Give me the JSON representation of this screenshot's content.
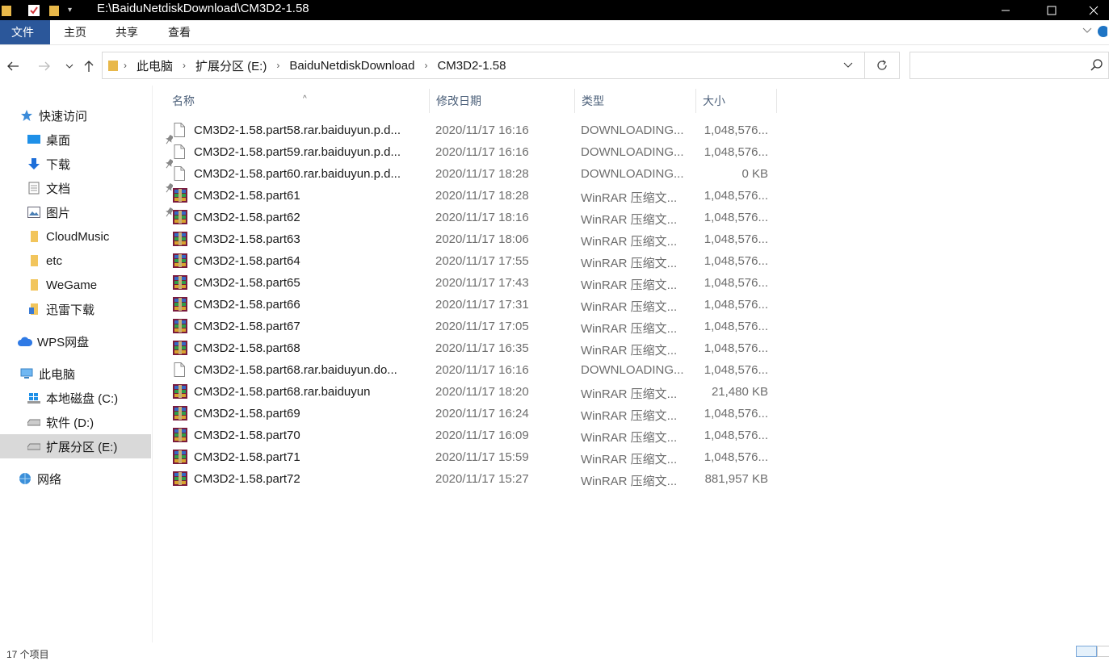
{
  "window": {
    "path": "E:\\BaiduNetdiskDownload\\CM3D2-1.58"
  },
  "ribbon": {
    "tabs": [
      "文件",
      "主页",
      "共享",
      "查看"
    ]
  },
  "breadcrumb": [
    "此电脑",
    "扩展分区 (E:)",
    "BaiduNetdiskDownload",
    "CM3D2-1.58"
  ],
  "search": {
    "placeholder": ""
  },
  "nav": {
    "quick_access": "快速访问",
    "pinned": [
      "桌面",
      "下载",
      "文档",
      "图片"
    ],
    "folders": [
      "CloudMusic",
      "etc",
      "WeGame",
      "迅雷下载"
    ],
    "wps": "WPS网盘",
    "this_pc": "此电脑",
    "drives": [
      "本地磁盘 (C:)",
      "软件 (D:)",
      "扩展分区 (E:)"
    ],
    "network": "网络"
  },
  "columns": {
    "name": "名称",
    "date": "修改日期",
    "type": "类型",
    "size": "大小"
  },
  "files": [
    {
      "name": "CM3D2-1.58.part58.rar.baiduyun.p.d...",
      "date": "2020/11/17 16:16",
      "type": "DOWNLOADING...",
      "size": "1,048,576...",
      "icon": "blank-file-icon"
    },
    {
      "name": "CM3D2-1.58.part59.rar.baiduyun.p.d...",
      "date": "2020/11/17 16:16",
      "type": "DOWNLOADING...",
      "size": "1,048,576...",
      "icon": "blank-file-icon"
    },
    {
      "name": "CM3D2-1.58.part60.rar.baiduyun.p.d...",
      "date": "2020/11/17 18:28",
      "type": "DOWNLOADING...",
      "size": "0 KB",
      "icon": "blank-file-icon"
    },
    {
      "name": "CM3D2-1.58.part61",
      "date": "2020/11/17 18:28",
      "type": "WinRAR 压缩文...",
      "size": "1,048,576...",
      "icon": "winrar-icon"
    },
    {
      "name": "CM3D2-1.58.part62",
      "date": "2020/11/17 18:16",
      "type": "WinRAR 压缩文...",
      "size": "1,048,576...",
      "icon": "winrar-icon"
    },
    {
      "name": "CM3D2-1.58.part63",
      "date": "2020/11/17 18:06",
      "type": "WinRAR 压缩文...",
      "size": "1,048,576...",
      "icon": "winrar-icon"
    },
    {
      "name": "CM3D2-1.58.part64",
      "date": "2020/11/17 17:55",
      "type": "WinRAR 压缩文...",
      "size": "1,048,576...",
      "icon": "winrar-icon"
    },
    {
      "name": "CM3D2-1.58.part65",
      "date": "2020/11/17 17:43",
      "type": "WinRAR 压缩文...",
      "size": "1,048,576...",
      "icon": "winrar-icon"
    },
    {
      "name": "CM3D2-1.58.part66",
      "date": "2020/11/17 17:31",
      "type": "WinRAR 压缩文...",
      "size": "1,048,576...",
      "icon": "winrar-icon"
    },
    {
      "name": "CM3D2-1.58.part67",
      "date": "2020/11/17 17:05",
      "type": "WinRAR 压缩文...",
      "size": "1,048,576...",
      "icon": "winrar-icon"
    },
    {
      "name": "CM3D2-1.58.part68",
      "date": "2020/11/17 16:35",
      "type": "WinRAR 压缩文...",
      "size": "1,048,576...",
      "icon": "winrar-icon"
    },
    {
      "name": "CM3D2-1.58.part68.rar.baiduyun.do...",
      "date": "2020/11/17 16:16",
      "type": "DOWNLOADING...",
      "size": "1,048,576...",
      "icon": "blank-file-icon"
    },
    {
      "name": "CM3D2-1.58.part68.rar.baiduyun",
      "date": "2020/11/17 18:20",
      "type": "WinRAR 压缩文...",
      "size": "21,480 KB",
      "icon": "winrar-icon"
    },
    {
      "name": "CM3D2-1.58.part69",
      "date": "2020/11/17 16:24",
      "type": "WinRAR 压缩文...",
      "size": "1,048,576...",
      "icon": "winrar-icon"
    },
    {
      "name": "CM3D2-1.58.part70",
      "date": "2020/11/17 16:09",
      "type": "WinRAR 压缩文...",
      "size": "1,048,576...",
      "icon": "winrar-icon"
    },
    {
      "name": "CM3D2-1.58.part71",
      "date": "2020/11/17 15:59",
      "type": "WinRAR 压缩文...",
      "size": "1,048,576...",
      "icon": "winrar-icon"
    },
    {
      "name": "CM3D2-1.58.part72",
      "date": "2020/11/17 15:27",
      "type": "WinRAR 压缩文...",
      "size": "881,957 KB",
      "icon": "winrar-icon"
    }
  ],
  "status": {
    "text": "17 个项目"
  },
  "colors": {
    "file_tab": "#2b579a",
    "selected_nav": "#d9d9d9",
    "header_text": "#4c607a"
  }
}
